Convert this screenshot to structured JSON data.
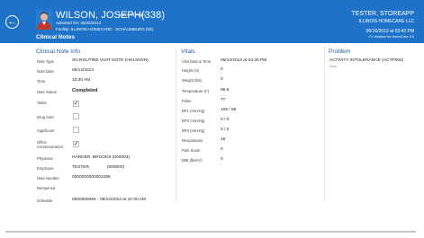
{
  "header": {
    "patient_name": "WILSON, JOSEPH(338)",
    "patient_meta": "Male, 73 Years",
    "admitted": "Admitted On: 05/25/2013",
    "facility": "Facility: ILLINOIS HOMECARE - SCHAUMBURG (53)",
    "section_title": "Clinical Notes",
    "user": "TESTER, STOREAPP",
    "agency": "ILLINOIS HOMECARE LLC",
    "date_time": "06/16/2013 at 03:42 PM",
    "version": "CV Intuitive for HomeCare 5.0"
  },
  "clinical_note": {
    "title": "Clinical Note Info",
    "rows": [
      {
        "label": "Note Type",
        "value": "SN ROUTINE VISIT NOTE (HH1SNVN)"
      },
      {
        "label": "Note Date",
        "value": "06/12/2013"
      },
      {
        "label": "Time",
        "value": "10:30 AM"
      },
      {
        "label": "Note Status",
        "value": "Completed"
      },
      {
        "label": "Tasks",
        "checked": true
      },
      {
        "label": "Drug Alert",
        "checked": false
      },
      {
        "label": "Significant",
        "checked": false
      },
      {
        "label": "Office Communication",
        "checked": true
      },
      {
        "label": "Physician",
        "value": "HARDER, BROOKS (000003)"
      },
      {
        "label": "Employee",
        "value": "TESTER,              (000000)"
      },
      {
        "label": "Note Number",
        "value": "0000000000002286"
      },
      {
        "label": "ReOpened",
        "value": ""
      },
      {
        "label": "Schedule",
        "value": "0000009356 - 06/12/2013 at 10:30 AM"
      }
    ]
  },
  "vitals": {
    "title": "Vitals",
    "rows": [
      {
        "label": "Visit Date & Time",
        "value": "06/10/2013 at 04:26 PM"
      },
      {
        "label": "Height (in)",
        "value": "0"
      },
      {
        "label": "Weight (lbs)",
        "value": "0"
      },
      {
        "label": "Temperature (F)",
        "value": "98.6"
      },
      {
        "label": "Pulse",
        "value": "77"
      },
      {
        "label": "BP1 (mm/Hg)",
        "value": "106 / 66"
      },
      {
        "label": "BP2 (mm/Hg)",
        "value": "0 / 0"
      },
      {
        "label": "BP3 (mm/Hg)",
        "value": "0 / 0"
      },
      {
        "label": "Respirations",
        "value": "16"
      },
      {
        "label": "Pain Scale",
        "value": "0"
      },
      {
        "label": "BMI (lbs/in²)",
        "value": "0"
      }
    ]
  },
  "problem": {
    "title": "Problem",
    "value": "ACTIVITY INTOLERANCE (ACTP002)",
    "status": "New"
  },
  "colors": {
    "header_bg": "#1e73c8",
    "accent": "#1e5fa8"
  }
}
